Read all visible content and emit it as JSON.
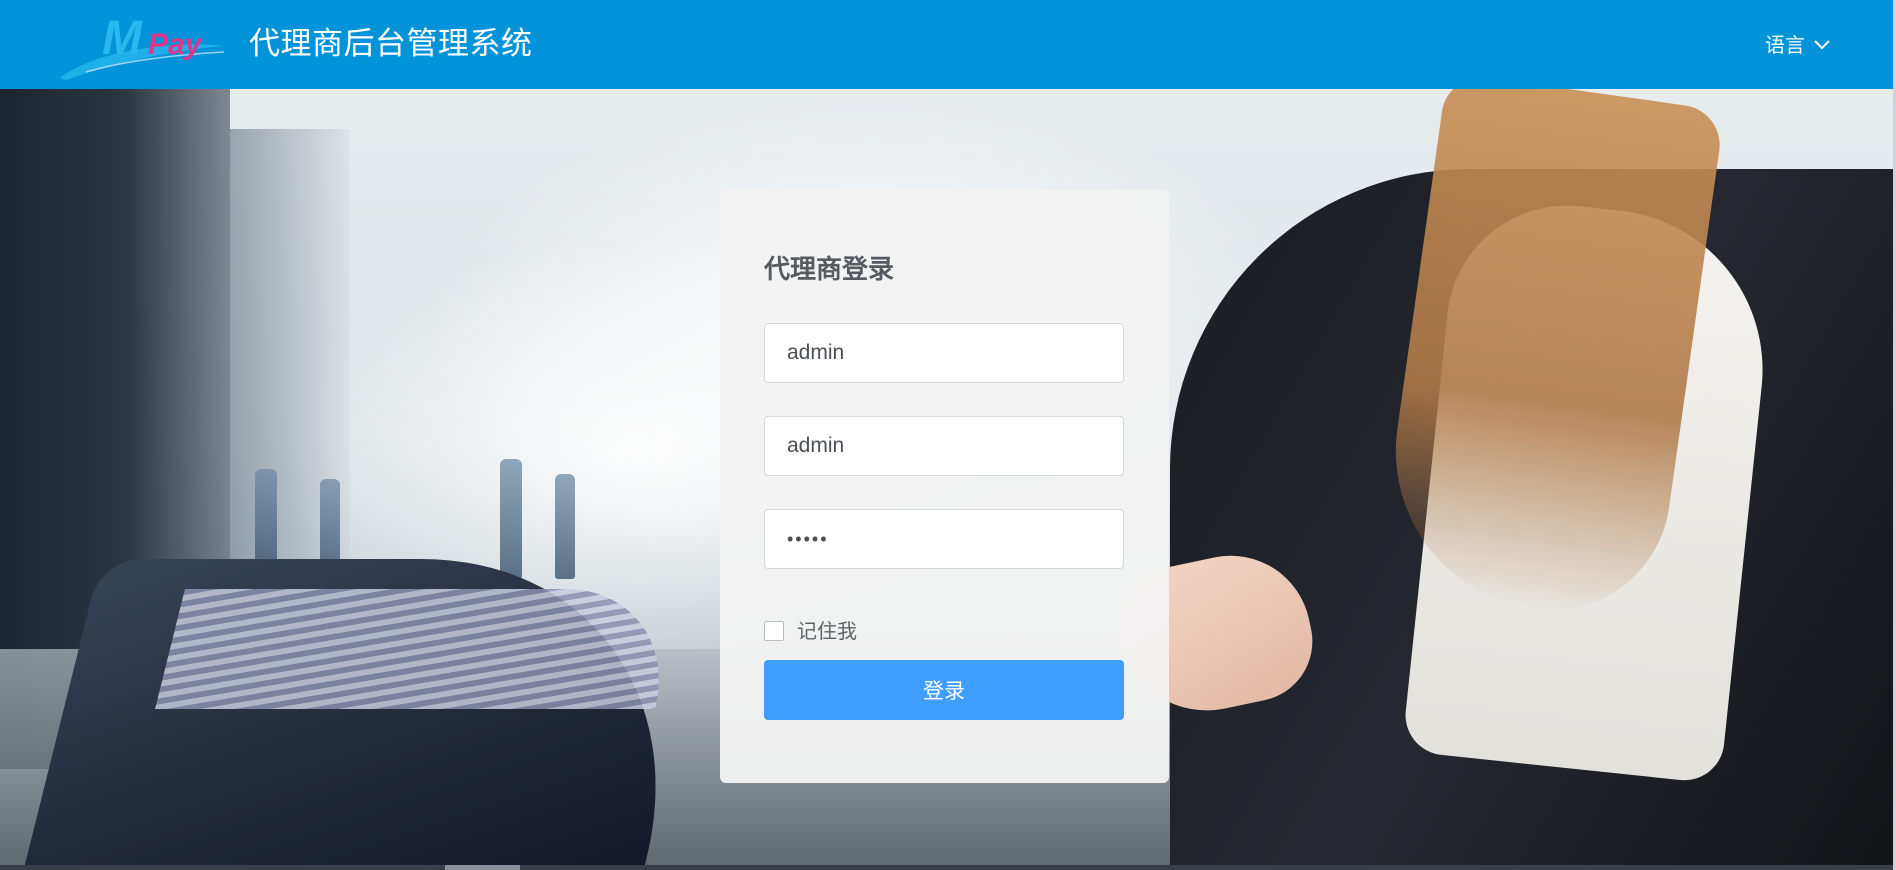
{
  "header": {
    "logo_text": "MPay",
    "title": "代理商后台管理系统",
    "language_label": "语言",
    "language_icon": "chevron-down-icon",
    "background_color": "#0393d8"
  },
  "login": {
    "title": "代理商登录",
    "agent_field_value": "admin",
    "username_field_value": "admin",
    "password_field_value": "•••••",
    "remember_label": "记住我",
    "submit_label": "登录",
    "button_color": "#409eff"
  }
}
